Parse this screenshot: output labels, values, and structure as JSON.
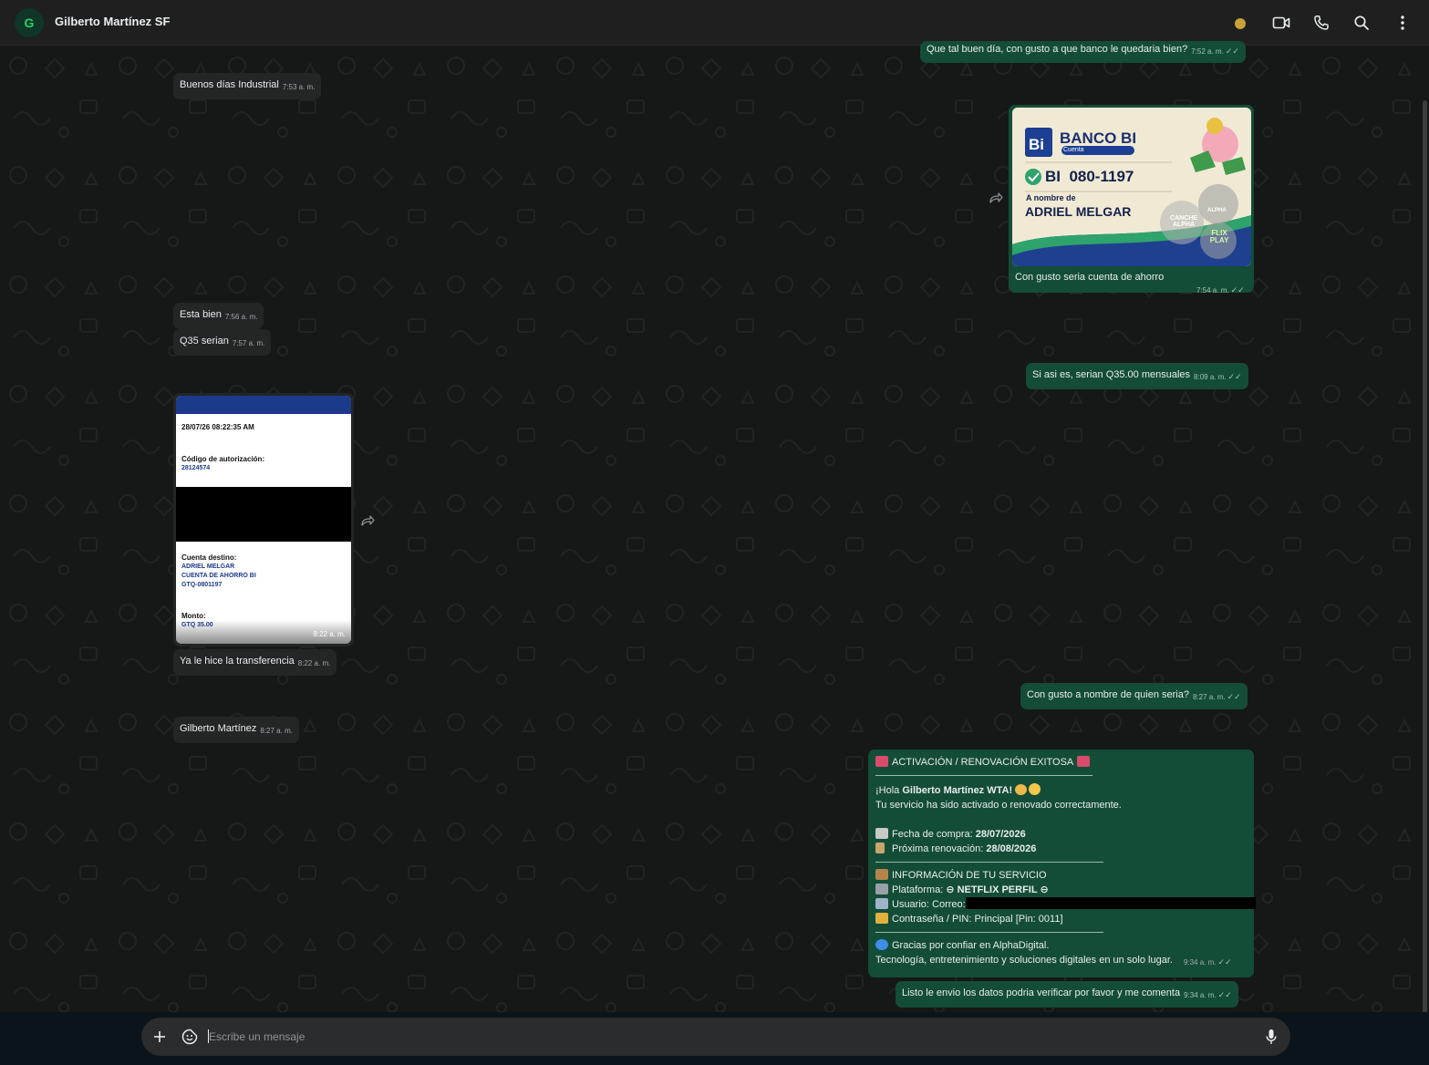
{
  "header": {
    "avatar_letter": "G",
    "contact_name": "Gilberto Martínez SF",
    "icons": [
      "status-dot",
      "video-call-icon",
      "phone-icon",
      "search-icon",
      "more-vertical-icon"
    ]
  },
  "messages": [
    {
      "dir": "out",
      "text": "Que tal buen día, con gusto a que banco le quedaria bien?",
      "time": "7:52 a. m."
    },
    {
      "dir": "in",
      "text": "Buenos días Industrial",
      "time": "7:53 a. m."
    },
    {
      "dir": "out",
      "text": "Con gusto seria cuenta de ahorro",
      "time": "7:54 a. m."
    },
    {
      "dir": "in",
      "text": "Esta bien",
      "time": "7:56 a. m."
    },
    {
      "dir": "in",
      "text": "Q35 serian",
      "time": "7:57 a. m."
    },
    {
      "dir": "out",
      "text": "Si asi es, serian Q35.00 mensuales",
      "time": "8:09 a. m."
    },
    {
      "dir": "in",
      "text": "Ya le hice la transferencia",
      "time": "8:22 a. m."
    },
    {
      "dir": "out",
      "text": "Con gusto a nombre de quien seria?",
      "time": "8:27 a. m."
    },
    {
      "dir": "in",
      "text": "Gilberto Martínez",
      "time": "8:27 a. m."
    },
    {
      "dir": "out",
      "text": "Listo le envio los datos podria verificar por favor y me comenta",
      "time": "9:34 a. m."
    }
  ],
  "bank_card": {
    "logo": "Bi",
    "bank_name": "BANCO BI",
    "account_type": "Cuenta",
    "account_number": "BI  080-1197",
    "holder_label": "A nombre de",
    "holder_name": "ADRIEL MELGAR",
    "watermark_1": "CANCHE ALPHA",
    "watermark_2": "ALPHA",
    "watermark_3": "FLIX PLAY"
  },
  "receipt": {
    "datetime": "28/07/26 08:22:35 AM",
    "auth_label": "Código de autorización:",
    "auth_code": "28124574",
    "dest_label": "Cuenta destino:",
    "dest_name": "ADRIEL MELGAR",
    "dest_type": "CUENTA DE AHORRO BI",
    "dest_account": "GTQ-0801197",
    "amount_label": "Monto:",
    "amount": "GTQ 35.00",
    "time": "8:22 a. m."
  },
  "activation": {
    "title": "ACTIVACIÓN / RENOVACIÓN EXITOSA",
    "greeting_prefix": "¡Hola ",
    "greeting_name": "Gilberto Martínez WTA!",
    "status_line": "Tu servicio ha sido activado o renovado correctamente.",
    "purchase_label": "Fecha de compra: ",
    "purchase_date": "28/07/2026",
    "renewal_label": "Próxima renovación: ",
    "renewal_date": "28/08/2026",
    "info_title": "INFORMACIÓN DE TU SERVICIO",
    "platform_label": "Plataforma: ",
    "platform_value": "⊖ NETFLIX PERFIL ⊖",
    "user_label": "Usuario: Correo:",
    "password_label": "Contraseña / PIN: Principal [Pin: 0011]",
    "thanks": "Gracias por confiar en AlphaDigital.",
    "tagline": "Tecnología, entretenimiento y soluciones digitales en un solo lugar.",
    "time": "9:34 a. m."
  },
  "composer": {
    "placeholder": "Escribe un mensaje"
  },
  "colors": {
    "incoming": "#242626",
    "outgoing": "#144d37",
    "background": "#161717",
    "accent": "#25d366"
  }
}
